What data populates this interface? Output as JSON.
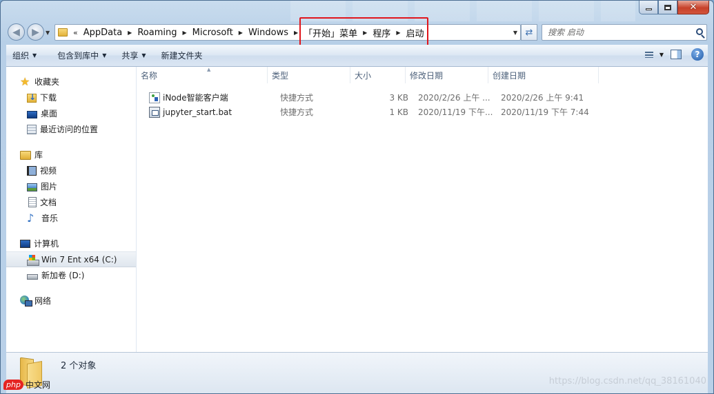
{
  "window": {
    "caption": {
      "close_glyph": "✕"
    }
  },
  "nav": {
    "back_glyph": "◀",
    "forward_glyph": "▶",
    "breadcrumb_overflow": "«",
    "breadcrumb": [
      "AppData",
      "Roaming",
      "Microsoft",
      "Windows",
      "「开始」菜单",
      "程序",
      "启动"
    ],
    "search_placeholder": "搜索 启动"
  },
  "toolbar": {
    "organize": "组织",
    "include_library": "包含到库中",
    "share": "共享",
    "new_folder": "新建文件夹",
    "help_glyph": "?"
  },
  "sidebar": {
    "favorites": {
      "label": "收藏夹",
      "items": [
        "下载",
        "桌面",
        "最近访问的位置"
      ]
    },
    "libraries": {
      "label": "库",
      "items": [
        "视频",
        "图片",
        "文档",
        "音乐"
      ]
    },
    "computer": {
      "label": "计算机",
      "items": [
        "Win 7 Ent x64 (C:)",
        "新加卷 (D:)"
      ]
    },
    "network": {
      "label": "网络"
    }
  },
  "columns": [
    "名称",
    "类型",
    "大小",
    "修改日期",
    "创建日期"
  ],
  "files": [
    {
      "name": "iNode智能客户端",
      "type": "快捷方式",
      "size": "3 KB",
      "modified": "2020/2/26 上午 ...",
      "created": "2020/2/26 上午 9:41",
      "icon": "inode-shortcut-icon"
    },
    {
      "name": "jupyter_start.bat",
      "type": "快捷方式",
      "size": "1 KB",
      "modified": "2020/11/19 下午...",
      "created": "2020/11/19 下午 7:44",
      "icon": "bat-shortcut-icon"
    }
  ],
  "status": {
    "count": "2 个对象"
  },
  "watermark": {
    "left_badge": "php",
    "left_text": "中文网",
    "right_text": "https://blog.csdn.net/qq_38161040"
  },
  "colors": {
    "highlight": "#e0151b",
    "selection": "#dfe6ee"
  }
}
